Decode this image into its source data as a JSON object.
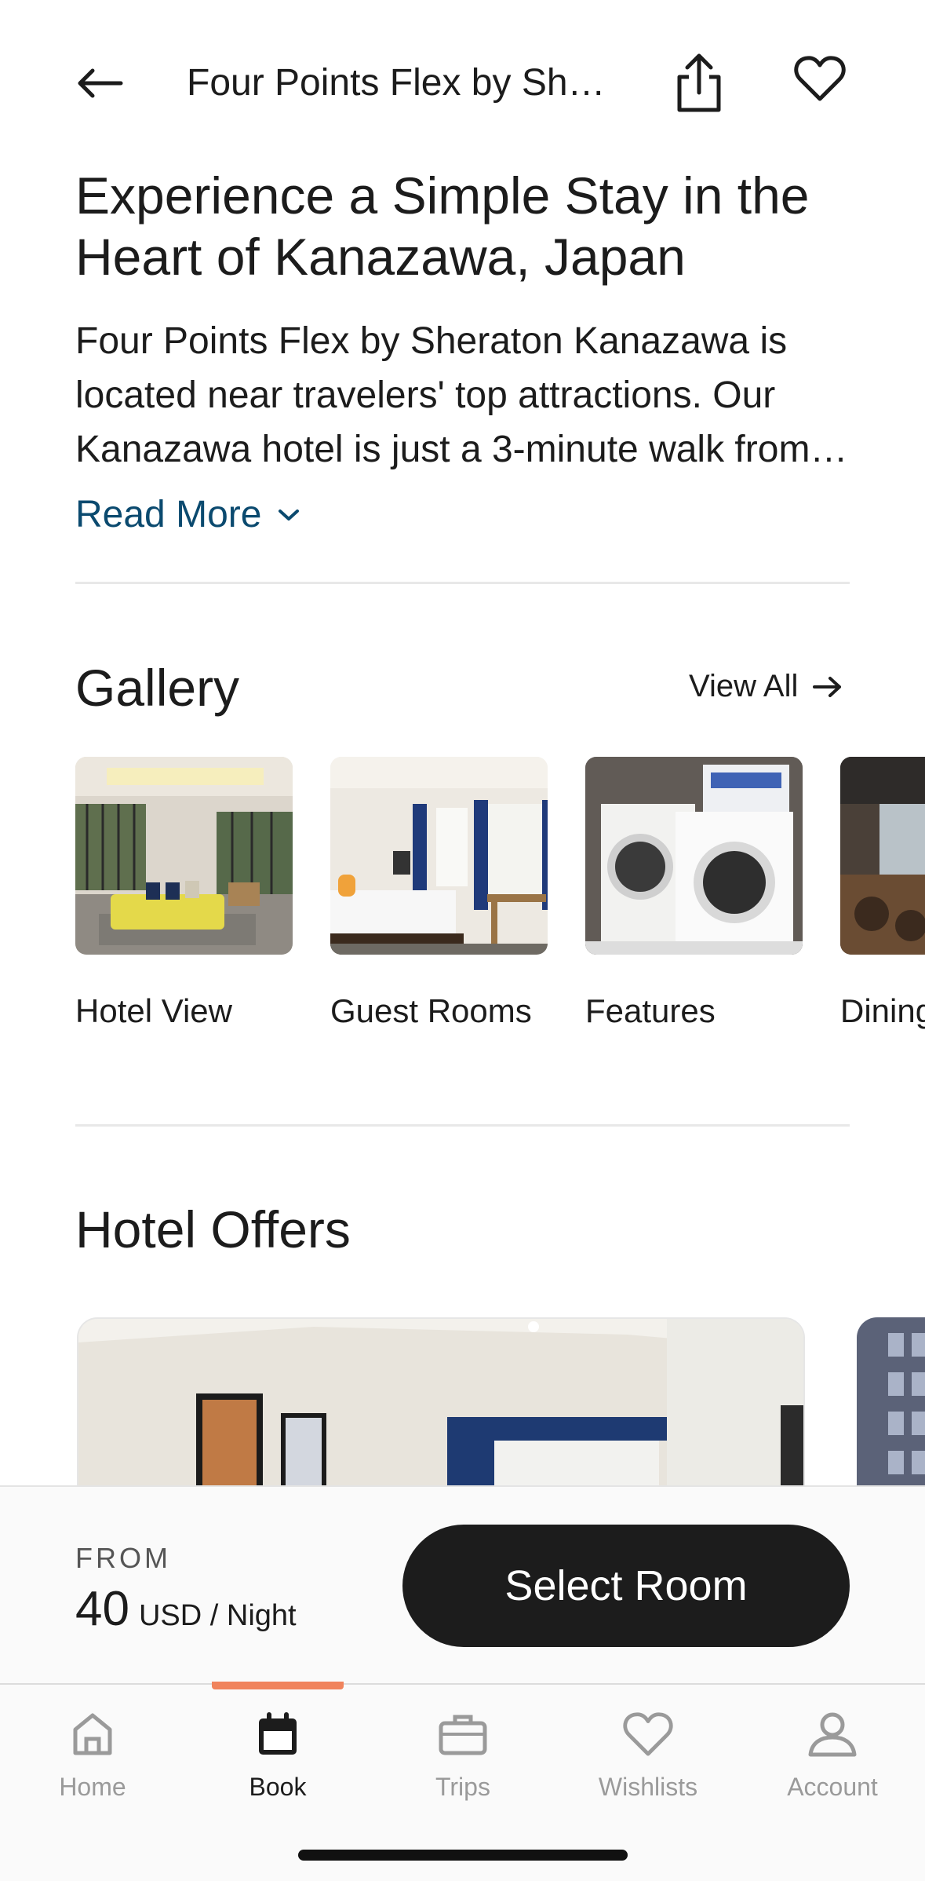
{
  "header": {
    "title": "Four Points Flex by Sh…",
    "back_icon": "arrow-left-icon",
    "share_icon": "share-icon",
    "favorite_icon": "heart-icon"
  },
  "intro": {
    "headline": "Experience a Simple Stay in the Heart of Kanazawa, Japan",
    "description": "Four Points Flex by Sheraton Kanazawa is located near travelers' top attractions. Our Kanazawa hotel is just a 3-minute walk from…",
    "read_more": "Read More"
  },
  "gallery": {
    "title": "Gallery",
    "view_all": "View All",
    "items": [
      {
        "label": "Hotel View"
      },
      {
        "label": "Guest Rooms"
      },
      {
        "label": "Features"
      },
      {
        "label": "Dining"
      }
    ]
  },
  "offers": {
    "title": "Hotel Offers"
  },
  "booking": {
    "from_label": "FROM",
    "price": "40",
    "price_unit": "USD / Night",
    "select_button": "Select Room"
  },
  "tabs": [
    {
      "label": "Home",
      "icon": "home-icon"
    },
    {
      "label": "Book",
      "icon": "calendar-icon"
    },
    {
      "label": "Trips",
      "icon": "briefcase-icon"
    },
    {
      "label": "Wishlists",
      "icon": "heart-icon"
    },
    {
      "label": "Account",
      "icon": "person-icon"
    }
  ],
  "colors": {
    "accent_link": "#0b4a6f",
    "tab_indicator": "#f0835c",
    "button_dark": "#1c1c1c"
  }
}
